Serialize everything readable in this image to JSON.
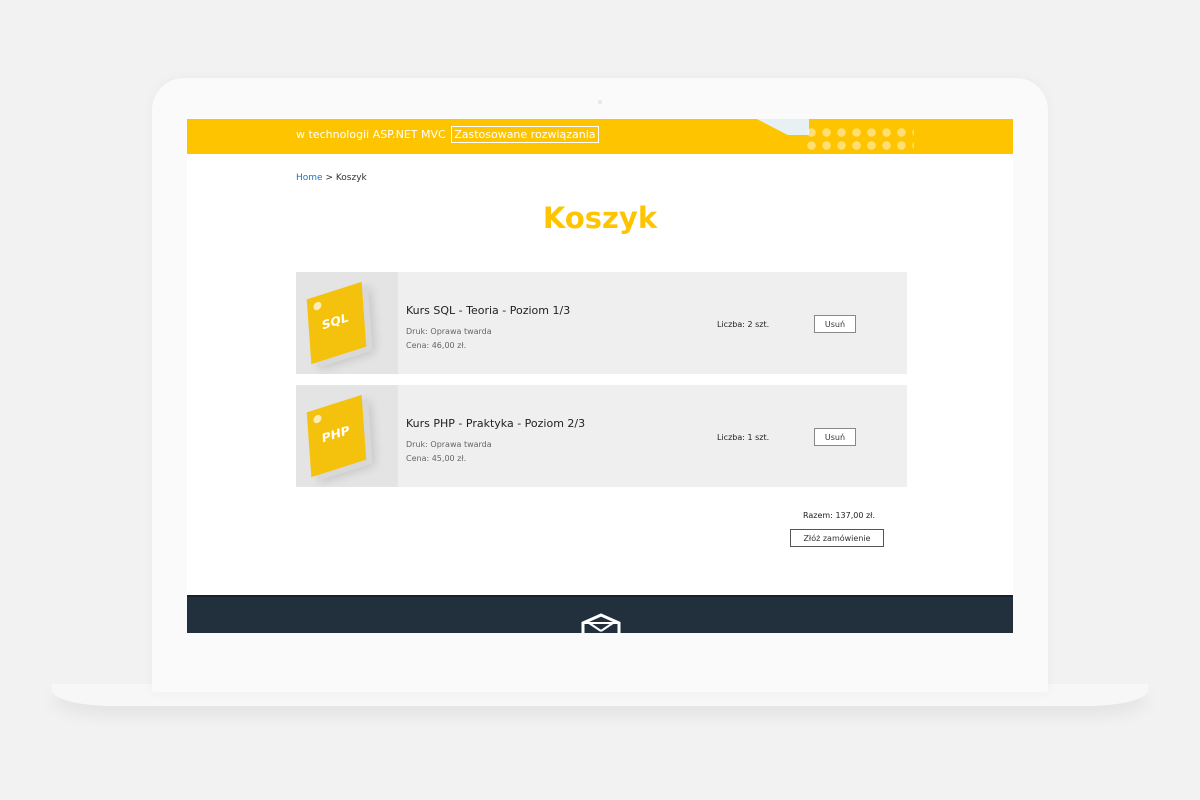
{
  "topbar": {
    "tagline": "w technologii ASP.NET MVC",
    "link_label": "Zastosowane rozwiązania"
  },
  "breadcrumb": {
    "home": "Home",
    "separator": " > ",
    "current": "Koszyk"
  },
  "page": {
    "title": "Koszyk"
  },
  "cart": {
    "items": [
      {
        "cover_label": "SQL",
        "title": "Kurs SQL - Teoria - Poziom 1/3",
        "print": "Druk: Oprawa twarda",
        "price": "Cena: 46,00 zł.",
        "quantity": "Liczba: 2 szt.",
        "remove_label": "Usuń"
      },
      {
        "cover_label": "PHP",
        "title": "Kurs PHP - Praktyka - Poziom 2/3",
        "print": "Druk: Oprawa twarda",
        "price": "Cena: 45,00 zł.",
        "quantity": "Liczba: 1 szt.",
        "remove_label": "Usuń"
      }
    ],
    "total": "Razem: 137,00 zł.",
    "order_label": "Złóż zamówienie"
  },
  "colors": {
    "accent": "#ffc400",
    "footer": "#22303e",
    "link": "#1a73c9"
  },
  "icons": {
    "footer_logo": "box-logo-icon"
  }
}
